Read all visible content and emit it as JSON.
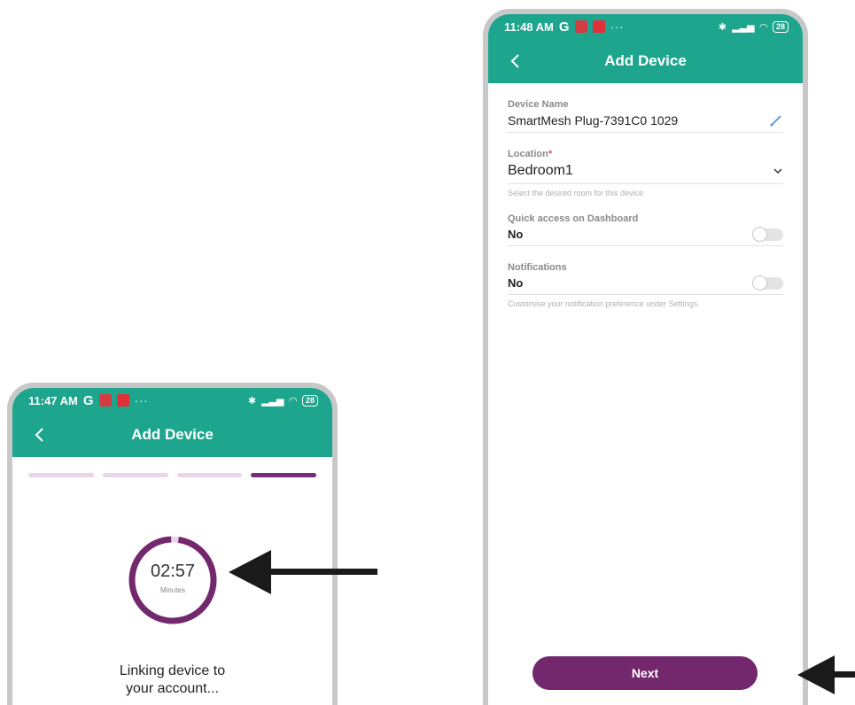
{
  "left_phone": {
    "status_time": "11:47 AM",
    "status_g": "G",
    "status_dots": "···",
    "status_battery": "28",
    "app_title": "Add Device",
    "steps": [
      false,
      false,
      false,
      true
    ],
    "timer_value": "02:57",
    "timer_unit": "Minutes",
    "timer_progress": 0.97,
    "linking_line1": "Linking device to",
    "linking_line2": "your account..."
  },
  "right_phone": {
    "status_time": "11:48 AM",
    "status_g": "G",
    "status_dots": "···",
    "status_battery": "28",
    "app_title": "Add Device",
    "device_name_label": "Device Name",
    "device_name_value": "SmartMesh Plug-7391C0 1029",
    "location_label": "Location",
    "location_required": "*",
    "location_value": "Bedroom1",
    "location_helper": "Select the desired room for this device",
    "quick_access_label": "Quick access on Dashboard",
    "quick_access_value": "No",
    "notifications_label": "Notifications",
    "notifications_value": "No",
    "notifications_helper": "Customise your notification preference under Settings.",
    "next_label": "Next"
  },
  "colors": {
    "teal": "#1ea58d",
    "purple": "#73286e",
    "step_inactive": "#ead6ea",
    "arrow": "#1a1a1a"
  },
  "icons": [
    "back-chevron-icon",
    "edit-pencil-icon",
    "chevron-down-icon",
    "bluetooth-icon",
    "signal-icon",
    "wifi-icon",
    "battery-icon",
    "arrow-left-icon"
  ]
}
